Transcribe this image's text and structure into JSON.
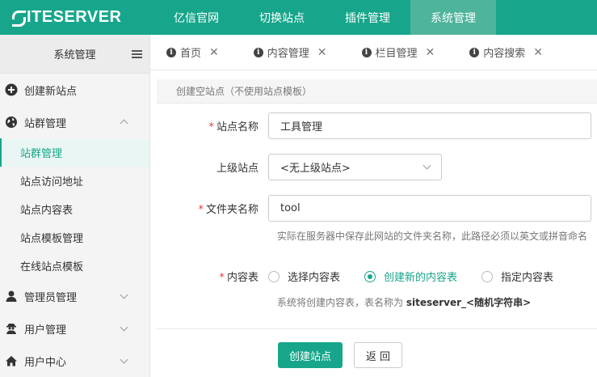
{
  "app": {
    "logo_text": "ITESERVER",
    "logo_letter": "S"
  },
  "topnav": {
    "items": [
      {
        "label": "亿信官网"
      },
      {
        "label": "切换站点"
      },
      {
        "label": "插件管理"
      },
      {
        "label": "系统管理"
      }
    ],
    "active_index": 3
  },
  "sidebar": {
    "header": "系统管理",
    "create_site": "创建新站点",
    "site_group": "站群管理",
    "sub_items": [
      "站群管理",
      "站点访问地址",
      "站点内容表",
      "站点模板管理",
      "在线站点模板"
    ],
    "admin": "管理员管理",
    "users": "用户管理",
    "user_center": "用户中心"
  },
  "tabs": [
    {
      "label": "首页"
    },
    {
      "label": "内容管理"
    },
    {
      "label": "栏目管理"
    },
    {
      "label": "内容搜索"
    }
  ],
  "form": {
    "panel_title": "创建空站点（不使用站点模板）",
    "site_name_label": "站点名称",
    "site_name_value": "工具管理",
    "parent_label": "上级站点",
    "parent_value": "<无上级站点>",
    "folder_label": "文件夹名称",
    "folder_value": "tool",
    "folder_help": "实际在服务器中保存此网站的文件夹名称，此路径必须以英文或拼音命名",
    "table_label": "内容表",
    "table_options": [
      "选择内容表",
      "创建新的内容表",
      "指定内容表"
    ],
    "table_selected_index": 1,
    "table_help_prefix": "系统将创建内容表，表名称为 ",
    "table_help_name": "siteserver_<随机字符串>",
    "submit_label": "创建站点",
    "back_label": "返 回"
  },
  "colors": {
    "accent": "#17a68b",
    "required": "#e4393c"
  }
}
